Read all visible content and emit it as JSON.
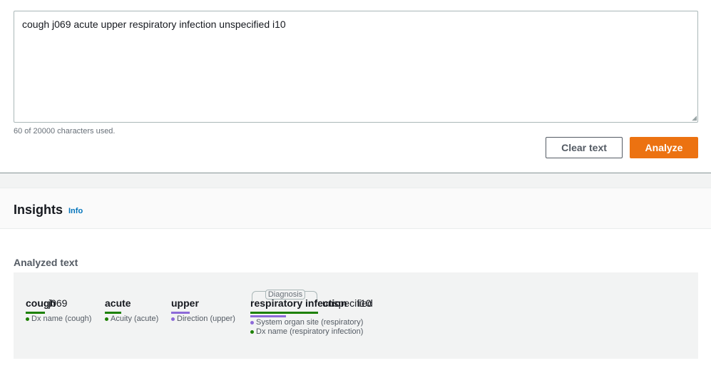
{
  "input": {
    "text": "cough j069 acute upper respiratory infection unspecified i10",
    "char_count_text": "60 of 20000 characters used."
  },
  "buttons": {
    "clear_label": "Clear text",
    "analyze_label": "Analyze"
  },
  "insights": {
    "title": "Insights",
    "info_label": "Info"
  },
  "analyzed": {
    "label": "Analyzed text",
    "tokens": {
      "cough": "cough",
      "j069": "j069",
      "acute": "acute",
      "upper": "upper",
      "respiratory_infection": "respiratory infection",
      "unspecified": "unspecified",
      "i10": "i10"
    },
    "attributes": {
      "cough": "Dx name (cough)",
      "acute": "Acuity (acute)",
      "upper": "Direction (upper)",
      "resp_1": "System organ site (respiratory)",
      "resp_2": "Dx name (respiratory infection)"
    },
    "relation_tag": "Diagnosis"
  },
  "colors": {
    "accent_orange": "#ec7211",
    "dx_green": "#1d8102",
    "attr_purple": "#8d6ad8",
    "link_blue": "#0073bb"
  }
}
